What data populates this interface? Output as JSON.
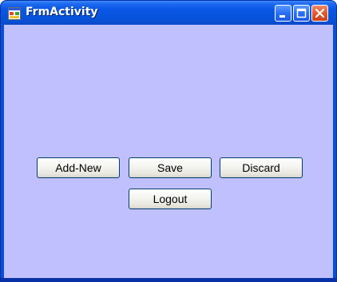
{
  "window": {
    "title": "FrmActivity",
    "icon": "form-icon",
    "controls": {
      "minimize_icon": "minimize-icon",
      "maximize_icon": "maximize-icon",
      "close_icon": "close-icon"
    }
  },
  "colors": {
    "client_background": "#c0c0ff",
    "titlebar": "#0a57e6",
    "close_button": "#e25a2a"
  },
  "buttons": {
    "add_new": "Add-New",
    "save": "Save",
    "discard": "Discard",
    "logout": "Logout"
  }
}
